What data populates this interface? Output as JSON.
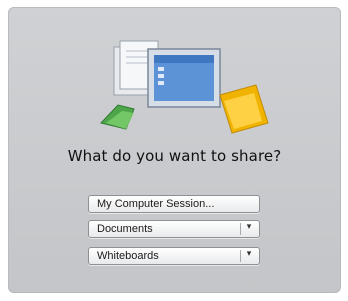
{
  "prompt": {
    "title": "What do you want to share?"
  },
  "options": {
    "session_button_label": "My Computer Session...",
    "documents_select": {
      "selected": "Documents",
      "arrow_icon": "chevron-down-icon"
    },
    "whiteboards_select": {
      "selected": "Whiteboards",
      "arrow_icon": "chevron-down-icon"
    }
  },
  "illustration": {
    "icons": [
      "document-icon",
      "monitor-window-icon",
      "green-folder-icon",
      "yellow-folder-icon"
    ],
    "colors": {
      "panel_bg": "#c8cacd",
      "window_blue": "#5b93d6",
      "window_frame": "#cfd7e2",
      "folder_green": "#4fa64a",
      "folder_yellow": "#f0b400"
    }
  }
}
